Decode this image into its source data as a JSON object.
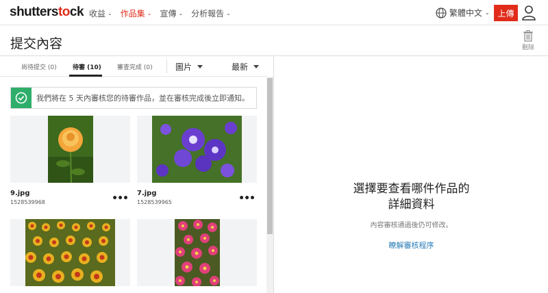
{
  "brand": {
    "logo_part1": "shutters",
    "logo_part2": "t",
    "logo_part3": "ck",
    "logo_o": "o"
  },
  "nav": [
    {
      "label": "收益"
    },
    {
      "label": "作品集"
    },
    {
      "label": "宣傳"
    },
    {
      "label": "分析報告"
    }
  ],
  "language": "繁體中文",
  "upload_label": "上傳",
  "page_title": "提交內容",
  "delete_label": "刪除",
  "tabs": [
    {
      "label": "尚待提交 (0)"
    },
    {
      "label": "待審 (10)"
    },
    {
      "label": "審查完成 (0)"
    }
  ],
  "filters": {
    "type": "圖片",
    "sort": "最新"
  },
  "notice": "我們將在 5 天內審核您的待審作品，並在審核完成後立即通知。",
  "images": [
    {
      "filename": "9.jpg",
      "id": "1528539968"
    },
    {
      "filename": "7.jpg",
      "id": "1528539965"
    },
    {
      "filename": "",
      "id": ""
    },
    {
      "filename": "",
      "id": ""
    }
  ],
  "more_label": "•••",
  "detail": {
    "title_line1": "選擇要查看哪件作品的",
    "title_line2": "詳細資料",
    "subtitle": "內容審核通過後仍可修改。",
    "link": "瞭解審核程序"
  },
  "colors": {
    "brand_red": "#e12c1a",
    "success_green": "#2eae6a",
    "link_blue": "#2a7db8"
  }
}
